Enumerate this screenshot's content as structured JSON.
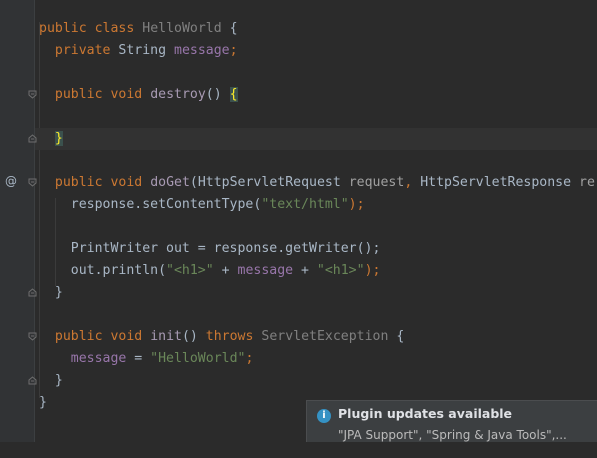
{
  "code": {
    "class_decl": {
      "kw_public": "public",
      "kw_class": "class",
      "class_name": "HelloWorld",
      "open_brace": " {"
    },
    "field_decl": {
      "kw_private": "private",
      "type": "String",
      "name": "message",
      "semi": ";"
    },
    "destroy_decl": {
      "kw_public": "public",
      "kw_void": "void",
      "name": "destroy",
      "parens": "() ",
      "open_brace": "{"
    },
    "destroy_close": "}",
    "doget_decl": {
      "kw_public": "public",
      "kw_void": "void",
      "name": "doGet",
      "open_paren": "(",
      "type1": "HttpServletRequest",
      "param1": "request",
      "comma": ", ",
      "type2": "HttpServletResponse",
      "param2": "re"
    },
    "set_content_type": {
      "target": "response.setContentType(",
      "arg": "\"text/html\"",
      "end": ");"
    },
    "print_writer": {
      "text": "PrintWriter out = response.getWriter();"
    },
    "println": {
      "prefix": "out.println(",
      "str1": "\"<h1>\"",
      "plus1": " + ",
      "field": "message",
      "plus2": " + ",
      "str2": "\"<h1>\"",
      "end": ");"
    },
    "doget_close": "}",
    "init_decl": {
      "kw_public": "public",
      "kw_void": "void",
      "name": "init",
      "parens": "() ",
      "kw_throws": "throws",
      "exception": "ServletException",
      "open_brace": " {"
    },
    "init_assign": {
      "field": "message",
      "eq": " = ",
      "str": "\"HelloWorld\"",
      "semi": ";"
    },
    "init_close": "}",
    "class_close": "}"
  },
  "gutter": {
    "override_marker": "@"
  },
  "notification": {
    "icon": "info-icon",
    "icon_glyph": "i",
    "title": "Plugin updates available",
    "body": "\"JPA Support\", \"Spring & Java Tools\",..."
  },
  "colors": {
    "background": "#2b2b2b",
    "keyword": "#cc7832",
    "string": "#6a8759",
    "field": "#9876aa",
    "method": "#a89ab3",
    "text": "#a9b7c6",
    "notification_bg": "#3c3f41"
  }
}
